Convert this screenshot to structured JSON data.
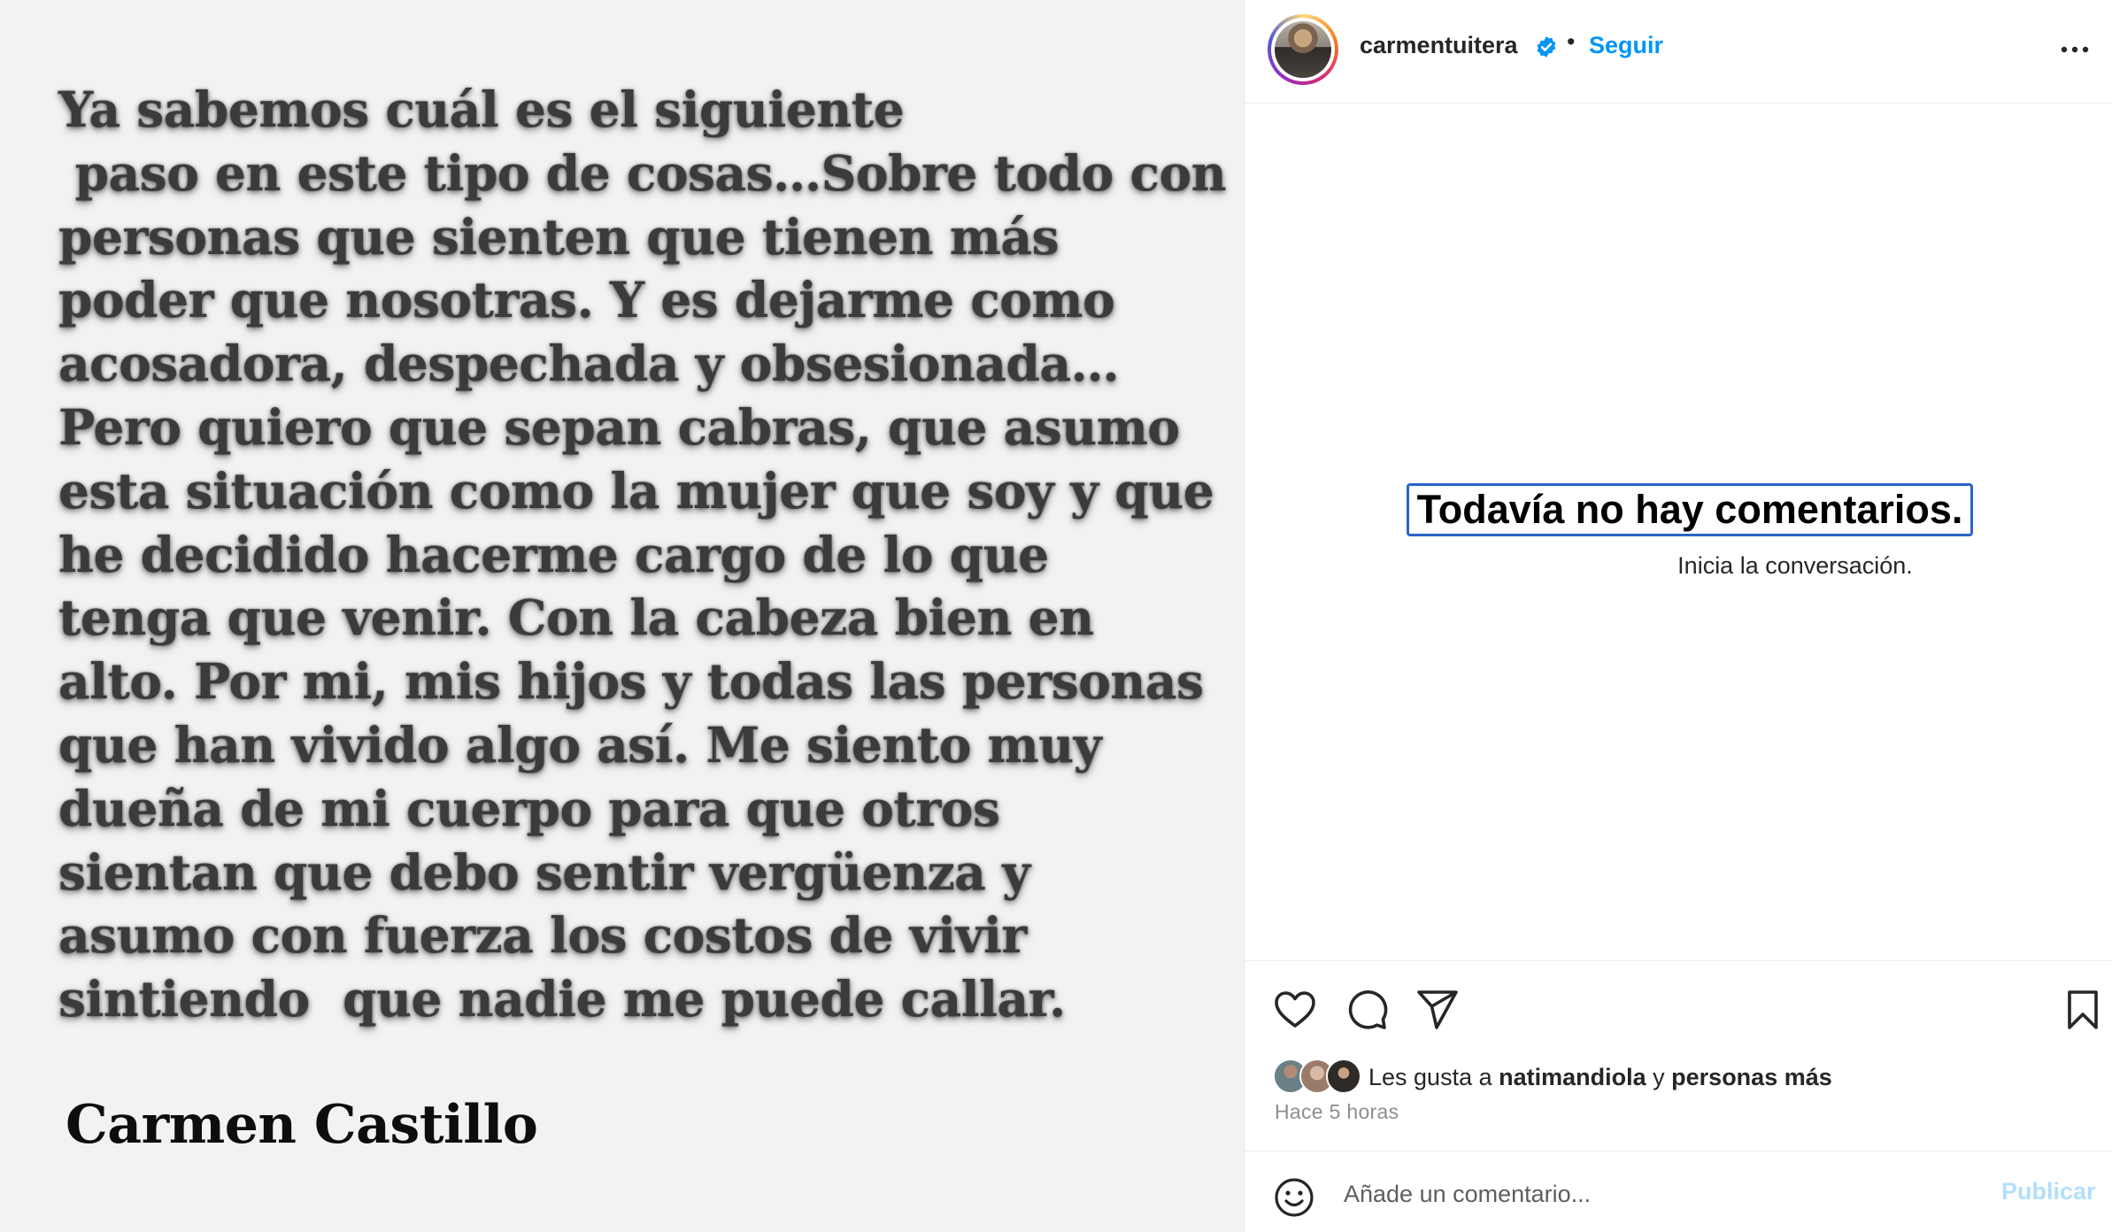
{
  "post_image": {
    "statement_lines": [
      "Ya sabemos cuál es el siguiente",
      " paso en este tipo de cosas…Sobre todo con",
      "personas que sienten que tienen más",
      "poder que nosotras. Y es dejarme como",
      "acosadora, despechada y obsesionada…",
      "Pero quiero que sepan cabras, que asumo",
      "esta situación como la mujer que soy y que",
      "he decidido hacerme cargo de lo que",
      "tenga que venir. Con la cabeza bien en",
      "alto. Por mi, mis hijos y todas las personas",
      "que han vivido algo así. Me siento muy",
      "dueña de mi cuerpo para que otros",
      "sientan que debo sentir vergüenza y",
      "asumo con fuerza los costos de vivir",
      "sintiendo  que nadie me puede callar."
    ],
    "signature": "Carmen Castillo"
  },
  "header": {
    "username": "carmentuitera",
    "separator": "•",
    "follow_label": "Seguir",
    "verified_icon": "verified-badge-icon",
    "more_icon": "more-options-icon"
  },
  "comments": {
    "empty_title": "Todavía no hay comentarios.",
    "empty_subtitle": "Inicia la conversación."
  },
  "actions": {
    "icons": [
      "heart-icon",
      "comment-icon",
      "share-icon",
      "bookmark-icon"
    ]
  },
  "likes": {
    "prefix": "Les gusta a ",
    "first_user": "natimandiola",
    "conjunction": " y ",
    "others": "personas más"
  },
  "timestamp": "Hace 5 horas",
  "comment_box": {
    "placeholder": "Añade un comentario...",
    "post_label": "Publicar"
  },
  "colors": {
    "accent": "#0095f6",
    "post_disabled": "#b2dffc",
    "highlight_border": "#2a64c7"
  }
}
